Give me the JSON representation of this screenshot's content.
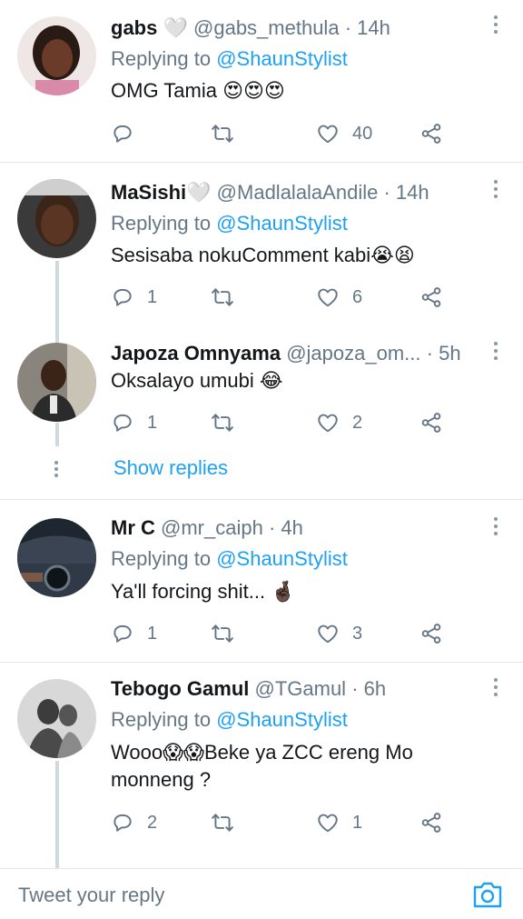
{
  "tweets": [
    {
      "name": "gabs",
      "name_emoji": "🤍",
      "handle": "@gabs_methula",
      "time": "14h",
      "replying_prefix": "Replying to",
      "replying_to": "@ShaunStylist",
      "text": "OMG Tamia 😍😍😍",
      "reply_count": "",
      "retweet_count": "",
      "like_count": "40"
    },
    {
      "name": "MaSishi",
      "name_emoji": "🤍",
      "handle": "@MadlalalaAndile",
      "time": "14h",
      "replying_prefix": "Replying to",
      "replying_to": "@ShaunStylist",
      "text": "Sesisaba nokuComment kabi😭😫",
      "reply_count": "1",
      "retweet_count": "",
      "like_count": "6"
    },
    {
      "name": "Japoza Omnyama",
      "name_emoji": "",
      "handle": "@japoza_om...",
      "time": "5h",
      "replying_prefix": "",
      "replying_to": "",
      "text": "Oksalayo umubi 😂",
      "reply_count": "1",
      "retweet_count": "",
      "like_count": "2"
    },
    {
      "name": "Mr C",
      "name_emoji": "",
      "handle": "@mr_caiph",
      "time": "4h",
      "replying_prefix": "Replying to",
      "replying_to": "@ShaunStylist",
      "text": "Ya'll forcing shit... 🤞🏿",
      "reply_count": "1",
      "retweet_count": "",
      "like_count": "3"
    },
    {
      "name": "Tebogo Gamul",
      "name_emoji": "",
      "handle": "@TGamul",
      "time": "6h",
      "replying_prefix": "Replying to",
      "replying_to": "@ShaunStylist",
      "text": "Wooo😱😱Beke ya ZCC ereng Mo monneng ?",
      "reply_count": "2",
      "retweet_count": "",
      "like_count": "1"
    }
  ],
  "show_replies_label": "Show replies",
  "composer": {
    "placeholder": "Tweet your reply",
    "camera_icon": "camera-icon"
  },
  "colors": {
    "accent": "#1da1f2",
    "secondary_text": "#657786",
    "divider": "#e1e8ed",
    "thread_line": "#cfd9de"
  }
}
